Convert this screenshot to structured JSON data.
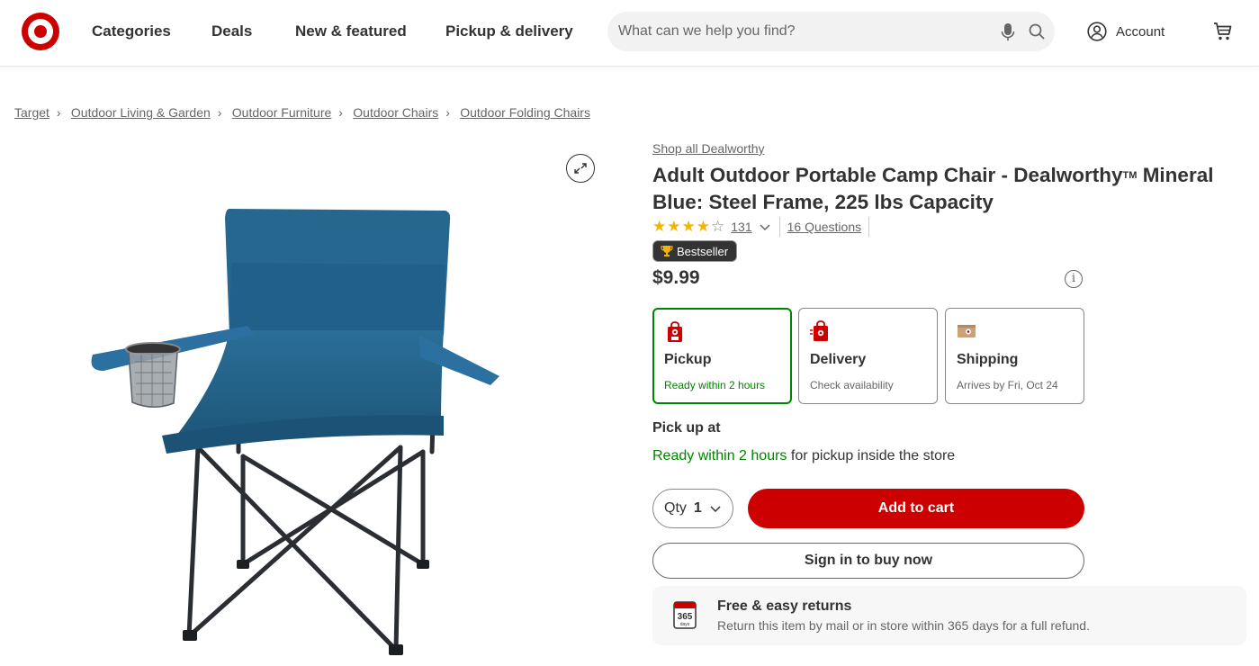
{
  "header": {
    "nav": [
      "Categories",
      "Deals",
      "New & featured",
      "Pickup & delivery"
    ],
    "search_placeholder": "What can we help you find?",
    "account_label": "Account",
    "brand_color": "#cc0000"
  },
  "breadcrumb": [
    "Target",
    "Outdoor Living & Garden",
    "Outdoor Furniture",
    "Outdoor Chairs",
    "Outdoor Folding Chairs"
  ],
  "product": {
    "shop_all": "Shop all Dealworthy",
    "title_part1": "Adult Outdoor Portable Camp Chair - Dealworthy",
    "title_tm": "TM",
    "title_part2": " Mineral Blue: Steel Frame, 225 lbs Capacity",
    "rating_value": 4,
    "rating_max": 5,
    "rating_count": "131",
    "questions": "16 Questions",
    "badge": "Bestseller",
    "price": "$9.99",
    "image_color": "#1f5f86"
  },
  "fulfillment": {
    "options": [
      {
        "name": "Pickup",
        "sub": "Ready within 2 hours",
        "selected": true
      },
      {
        "name": "Delivery",
        "sub": "Check availability",
        "selected": false
      },
      {
        "name": "Shipping",
        "sub": "Arrives by Fri, Oct 24",
        "selected": false
      }
    ],
    "pickup_heading": "Pick up at",
    "pickup_ready": "Ready within 2 hours",
    "pickup_rest": " for pickup inside the store"
  },
  "actions": {
    "qty_label": "Qty",
    "qty_value": "1",
    "add_to_cart": "Add to cart",
    "sign_in": "Sign in to buy now"
  },
  "returns": {
    "icon_number": "365",
    "icon_unit": "days",
    "title": "Free & easy returns",
    "subtitle": "Return this item by mail or in store within 365 days for a full refund."
  }
}
